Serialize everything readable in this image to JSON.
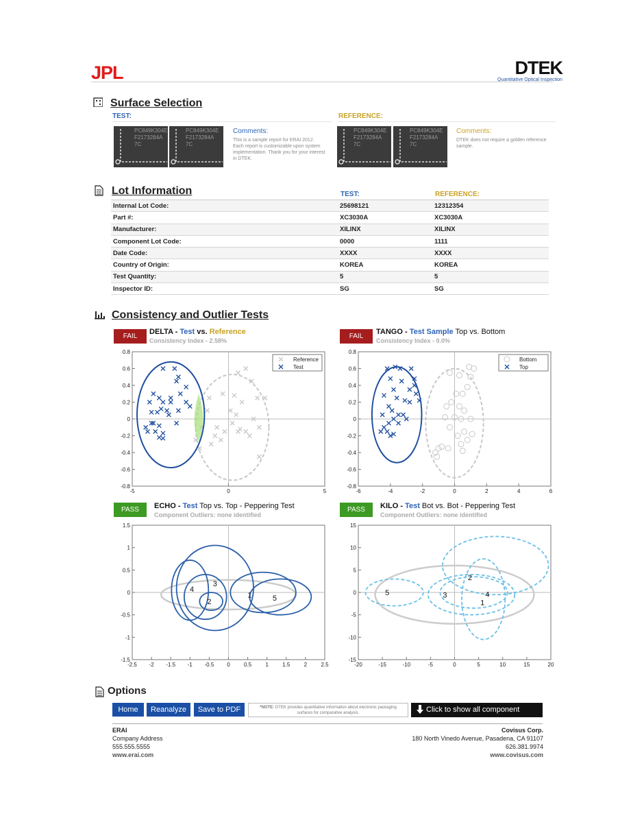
{
  "header": {
    "jpl_logo": "JPL",
    "dtek_logo": "DTEK",
    "dtek_tagline": "Quantitative Optical Inspection"
  },
  "surface": {
    "title": "Surface Selection",
    "test_label": "TEST:",
    "ref_label": "REFERENCE:",
    "chip_text": [
      "PC849K304E",
      "F2173284A",
      "7C"
    ],
    "test_comments_title": "Comments:",
    "test_comments": "This is a sample report for ERAI 2012. Each report is customizable upon system implementation.  Thank you for your interest in DTEK.",
    "ref_comments_title": "Comments:",
    "ref_comments": "DTEK does not require a golden reference sample."
  },
  "lot": {
    "title": "Lot Information",
    "test_label": "TEST:",
    "ref_label": "REFERENCE:",
    "rows": [
      {
        "label": "Internal Lot Code:",
        "test": "25698121",
        "ref": "12312354"
      },
      {
        "label": "Part #:",
        "test": "XC3030A",
        "ref": "XC3030A"
      },
      {
        "label": "Manufacturer:",
        "test": "XILINX",
        "ref": "XILINX"
      },
      {
        "label": "Component Lot Code:",
        "test": "0000",
        "ref": "1111"
      },
      {
        "label": "Date Code:",
        "test": "XXXX",
        "ref": "XXXX"
      },
      {
        "label": "Country of Origin:",
        "test": "KOREA",
        "ref": "KOREA"
      },
      {
        "label": "Test Quantity:",
        "test": "5",
        "ref": "5"
      },
      {
        "label": "Inspector ID:",
        "test": "SG",
        "ref": "SG"
      }
    ]
  },
  "tests": {
    "title": "Consistency and Outlier Tests",
    "fail_label": "FAIL",
    "pass_label": "PASS",
    "delta": {
      "name": "DELTA",
      "sep": " - ",
      "a": "Test",
      "vs": " vs. ",
      "b": "Reference",
      "sub": "Consistency Index - 2.58%"
    },
    "tango": {
      "name": "TANGO",
      "sep": " - ",
      "a": "Test Sample",
      "rest": " Top vs. Bottom",
      "sub": "Consistency Index - 0.0%"
    },
    "echo": {
      "name": "ECHO",
      "sep": " - ",
      "a": "Test",
      "rest": " Top vs. Top - Peppering Test",
      "sub": "Component Outliers: none identified"
    },
    "kilo": {
      "name": "KILO",
      "sep": " - ",
      "a": "Test",
      "rest": " Bot vs. Bot - Peppering Test",
      "sub": "Component Outliers: none identified"
    }
  },
  "chart_data": [
    {
      "type": "scatter",
      "title": "DELTA",
      "xlim": [
        -5,
        5
      ],
      "ylim": [
        -0.8,
        0.8
      ],
      "xticks": [
        -5,
        0,
        5
      ],
      "yticks": [
        -0.8,
        -0.6,
        -0.4,
        -0.2,
        0,
        0.2,
        0.4,
        0.6,
        0.8
      ],
      "legend": "top-right",
      "series": [
        {
          "name": "Reference",
          "color": "#c8c8c8",
          "marker": "x",
          "ellipse": {
            "cx": 0.2,
            "cy": -0.1,
            "rx": 1.9,
            "ry": 0.63
          },
          "points": [
            [
              -0.9,
              -0.3
            ],
            [
              -1.5,
              -0.35
            ],
            [
              -0.7,
              -0.2
            ],
            [
              -1.7,
              -0.25
            ],
            [
              -1.1,
              0.1
            ],
            [
              -0.6,
              -0.1
            ],
            [
              -0.3,
              0.3
            ],
            [
              0.4,
              0.05
            ],
            [
              0.9,
              0.6
            ],
            [
              1.2,
              0.45
            ],
            [
              0.3,
              0.28
            ],
            [
              0.7,
              0.2
            ],
            [
              1.3,
              0.0
            ],
            [
              1.6,
              -0.1
            ],
            [
              0.5,
              -0.15
            ],
            [
              0.9,
              -0.15
            ],
            [
              1.1,
              -0.2
            ],
            [
              -0.2,
              -0.15
            ],
            [
              0.2,
              -0.05
            ],
            [
              0.6,
              -0.12
            ],
            [
              1.9,
              0.25
            ],
            [
              1.6,
              -0.45
            ],
            [
              -0.4,
              -0.25
            ],
            [
              -1.4,
              -0.1
            ],
            [
              1.5,
              0.25
            ],
            [
              0.5,
              0.55
            ],
            [
              -1.0,
              0.25
            ],
            [
              0.1,
              0.1
            ]
          ]
        },
        {
          "name": "Test",
          "color": "#1f4e9e",
          "marker": "x",
          "ellipse": {
            "cx": -3.0,
            "cy": 0.05,
            "rx": 1.75,
            "ry": 0.63
          },
          "points": [
            [
              -3.4,
              0.6
            ],
            [
              -2.8,
              0.6
            ],
            [
              -3.9,
              0.3
            ],
            [
              -3.6,
              0.25
            ],
            [
              -3.0,
              0.25
            ],
            [
              -2.5,
              0.3
            ],
            [
              -4.1,
              0.2
            ],
            [
              -3.4,
              0.2
            ],
            [
              -3.0,
              0.2
            ],
            [
              -2.2,
              0.2
            ],
            [
              -3.2,
              0.1
            ],
            [
              -2.6,
              0.1
            ],
            [
              -3.5,
              0.12
            ],
            [
              -3.7,
              0.08
            ],
            [
              -4.0,
              0.08
            ],
            [
              -3.9,
              -0.05
            ],
            [
              -3.6,
              -0.08
            ],
            [
              -3.1,
              0.05
            ],
            [
              -2.7,
              -0.05
            ],
            [
              -4.3,
              -0.1
            ],
            [
              -3.8,
              -0.15
            ],
            [
              -4.2,
              -0.15
            ],
            [
              -3.4,
              -0.17
            ],
            [
              -3.4,
              -0.23
            ],
            [
              -3.6,
              -0.22
            ],
            [
              -2.6,
              0.5
            ],
            [
              -2.7,
              0.45
            ],
            [
              -2.2,
              0.38
            ],
            [
              -2.0,
              0.15
            ],
            [
              -4.0,
              -0.05
            ]
          ]
        }
      ]
    },
    {
      "type": "scatter",
      "title": "TANGO",
      "xlim": [
        -6,
        6
      ],
      "ylim": [
        -0.8,
        0.8
      ],
      "xticks": [
        -6,
        -4,
        -2,
        0,
        2,
        4,
        6
      ],
      "yticks": [
        -0.8,
        -0.6,
        -0.4,
        -0.2,
        0,
        0.2,
        0.4,
        0.6,
        0.8
      ],
      "legend": "top-right",
      "series": [
        {
          "name": "Bottom",
          "color": "#c8c8c8",
          "marker": "o",
          "ellipse": {
            "cx": 0.0,
            "cy": -0.05,
            "rx": 1.8,
            "ry": 0.65
          },
          "points": [
            [
              -1.2,
              -0.4
            ],
            [
              -1.0,
              -0.35
            ],
            [
              -0.8,
              -0.33
            ],
            [
              -1.1,
              -0.45
            ],
            [
              -0.4,
              -0.35
            ],
            [
              0.4,
              -0.3
            ],
            [
              0.5,
              -0.38
            ],
            [
              0.8,
              -0.25
            ],
            [
              0.2,
              -0.2
            ],
            [
              0.6,
              -0.15
            ],
            [
              -0.3,
              -0.1
            ],
            [
              0.0,
              0.02
            ],
            [
              0.4,
              0.0
            ],
            [
              1.0,
              0.0
            ],
            [
              0.6,
              0.1
            ],
            [
              0.3,
              0.15
            ],
            [
              -0.5,
              0.15
            ],
            [
              -0.2,
              0.2
            ],
            [
              0.1,
              0.3
            ],
            [
              0.5,
              0.3
            ],
            [
              0.8,
              0.38
            ],
            [
              1.0,
              0.5
            ],
            [
              1.2,
              0.6
            ],
            [
              0.9,
              0.62
            ],
            [
              0.3,
              0.52
            ],
            [
              -0.3,
              0.55
            ],
            [
              -0.6,
              0.02
            ],
            [
              1.1,
              -0.18
            ]
          ]
        },
        {
          "name": "Top",
          "color": "#1f4e9e",
          "marker": "x",
          "ellipse": {
            "cx": -3.6,
            "cy": 0.05,
            "rx": 1.55,
            "ry": 0.57
          },
          "points": [
            [
              -4.2,
              0.6
            ],
            [
              -3.7,
              0.62
            ],
            [
              -3.4,
              0.6
            ],
            [
              -2.7,
              0.6
            ],
            [
              -4.0,
              0.48
            ],
            [
              -3.3,
              0.45
            ],
            [
              -2.5,
              0.48
            ],
            [
              -3.8,
              0.35
            ],
            [
              -2.8,
              0.35
            ],
            [
              -4.4,
              0.28
            ],
            [
              -3.6,
              0.25
            ],
            [
              -3.1,
              0.22
            ],
            [
              -2.8,
              0.2
            ],
            [
              -2.2,
              0.22
            ],
            [
              -4.1,
              0.15
            ],
            [
              -3.9,
              0.1
            ],
            [
              -3.2,
              0.05
            ],
            [
              -3.5,
              0.05
            ],
            [
              -4.5,
              0.05
            ],
            [
              -4.1,
              -0.05
            ],
            [
              -3.8,
              0.0
            ],
            [
              -3.0,
              0.0
            ],
            [
              -4.4,
              -0.1
            ],
            [
              -4.2,
              -0.15
            ],
            [
              -3.8,
              -0.18
            ],
            [
              -4.0,
              -0.2
            ],
            [
              -4.6,
              -0.15
            ],
            [
              -3.5,
              -0.05
            ],
            [
              -2.5,
              0.4
            ],
            [
              -2.4,
              0.3
            ]
          ]
        }
      ]
    },
    {
      "type": "ellipse-plot",
      "title": "ECHO",
      "xlim": [
        -2.5,
        2.5
      ],
      "ylim": [
        -1.5,
        1.5
      ],
      "xticks": [
        -2.5,
        -2,
        -1.5,
        -1,
        -0.5,
        0,
        0.5,
        1,
        1.5,
        2,
        2.5
      ],
      "yticks": [
        -1.5,
        -1,
        -0.5,
        0,
        0.5,
        1,
        1.5
      ],
      "labels": [
        "1",
        "2",
        "3",
        "4",
        "5"
      ],
      "label_points": [
        [
          0.55,
          -0.05
        ],
        [
          -0.5,
          -0.2
        ],
        [
          -0.35,
          0.2
        ],
        [
          -0.95,
          0.08
        ],
        [
          1.2,
          -0.12
        ]
      ],
      "ellipses": [
        {
          "cx": 0.0,
          "cy": -0.05,
          "rx": 1.75,
          "ry": 0.33,
          "color": "#cccccc"
        },
        {
          "cx": -0.35,
          "cy": 0.1,
          "rx": 1.0,
          "ry": 0.95,
          "color": "#2a5fa9"
        },
        {
          "cx": -1.0,
          "cy": 0.05,
          "rx": 0.48,
          "ry": 0.67,
          "color": "#2a5fa9"
        },
        {
          "cx": -0.45,
          "cy": -0.2,
          "rx": 0.3,
          "ry": 0.2,
          "color": "#2a5fa9"
        },
        {
          "cx": -0.6,
          "cy": -0.1,
          "rx": 0.55,
          "ry": 0.5,
          "color": "#2a5fa9"
        },
        {
          "cx": 0.9,
          "cy": 0.0,
          "rx": 0.85,
          "ry": 0.45,
          "color": "#2a5fa9"
        },
        {
          "cx": 1.35,
          "cy": -0.1,
          "rx": 0.8,
          "ry": 0.4,
          "color": "#2a5fa9"
        }
      ]
    },
    {
      "type": "ellipse-plot",
      "title": "KILO",
      "xlim": [
        -20,
        20
      ],
      "ylim": [
        -15,
        15
      ],
      "xticks": [
        -20,
        -15,
        -10,
        -5,
        0,
        5,
        10,
        15,
        20
      ],
      "yticks": [
        -15,
        -10,
        -5,
        0,
        5,
        10,
        15
      ],
      "labels": [
        "1",
        "2",
        "3",
        "4",
        "5"
      ],
      "label_points": [
        [
          5.8,
          -2.2
        ],
        [
          3.2,
          3.4
        ],
        [
          -2,
          -0.5
        ],
        [
          6.8,
          -0.4
        ],
        [
          -14,
          0
        ]
      ],
      "ellipses": [
        {
          "cx": 0.0,
          "cy": -0.5,
          "rx": 16.5,
          "ry": 6.5,
          "color": "#cccccc"
        },
        {
          "cx": 8.5,
          "cy": 6.0,
          "rx": 11.0,
          "ry": 6.5,
          "color": "#6cc0e8",
          "dashed": true
        },
        {
          "cx": 6.0,
          "cy": -1.5,
          "rx": 4.5,
          "ry": 9.0,
          "color": "#6cc0e8",
          "dashed": true
        },
        {
          "cx": 4.0,
          "cy": 0.0,
          "rx": 7.0,
          "ry": 3.5,
          "color": "#6cc0e8",
          "dashed": true
        },
        {
          "cx": 3.5,
          "cy": -0.5,
          "rx": 9.0,
          "ry": 4.5,
          "color": "#6cc0e8",
          "dashed": true
        },
        {
          "cx": -12.5,
          "cy": 0.0,
          "rx": 6.0,
          "ry": 3.0,
          "color": "#6cc0e8",
          "dashed": true
        }
      ]
    }
  ],
  "options": {
    "title": "Options",
    "home": "Home",
    "reanalyze": "Reanalyze",
    "save_pdf": "Save to PDF",
    "note_prefix": "*NOTE:",
    "note": "DTEK provides quantitative information about electronic packaging surfaces for comparative analysis.",
    "show_images": "Click to show all component images."
  },
  "footer": {
    "left": [
      "ERAI",
      "Company Address",
      "555.555.5555",
      "www.erai.com"
    ],
    "right": [
      "Covisus Corp.",
      "180 North Vinedo Avenue, Pasadena, CA 91107",
      "626.381.9974",
      "www.covisus.com"
    ]
  }
}
